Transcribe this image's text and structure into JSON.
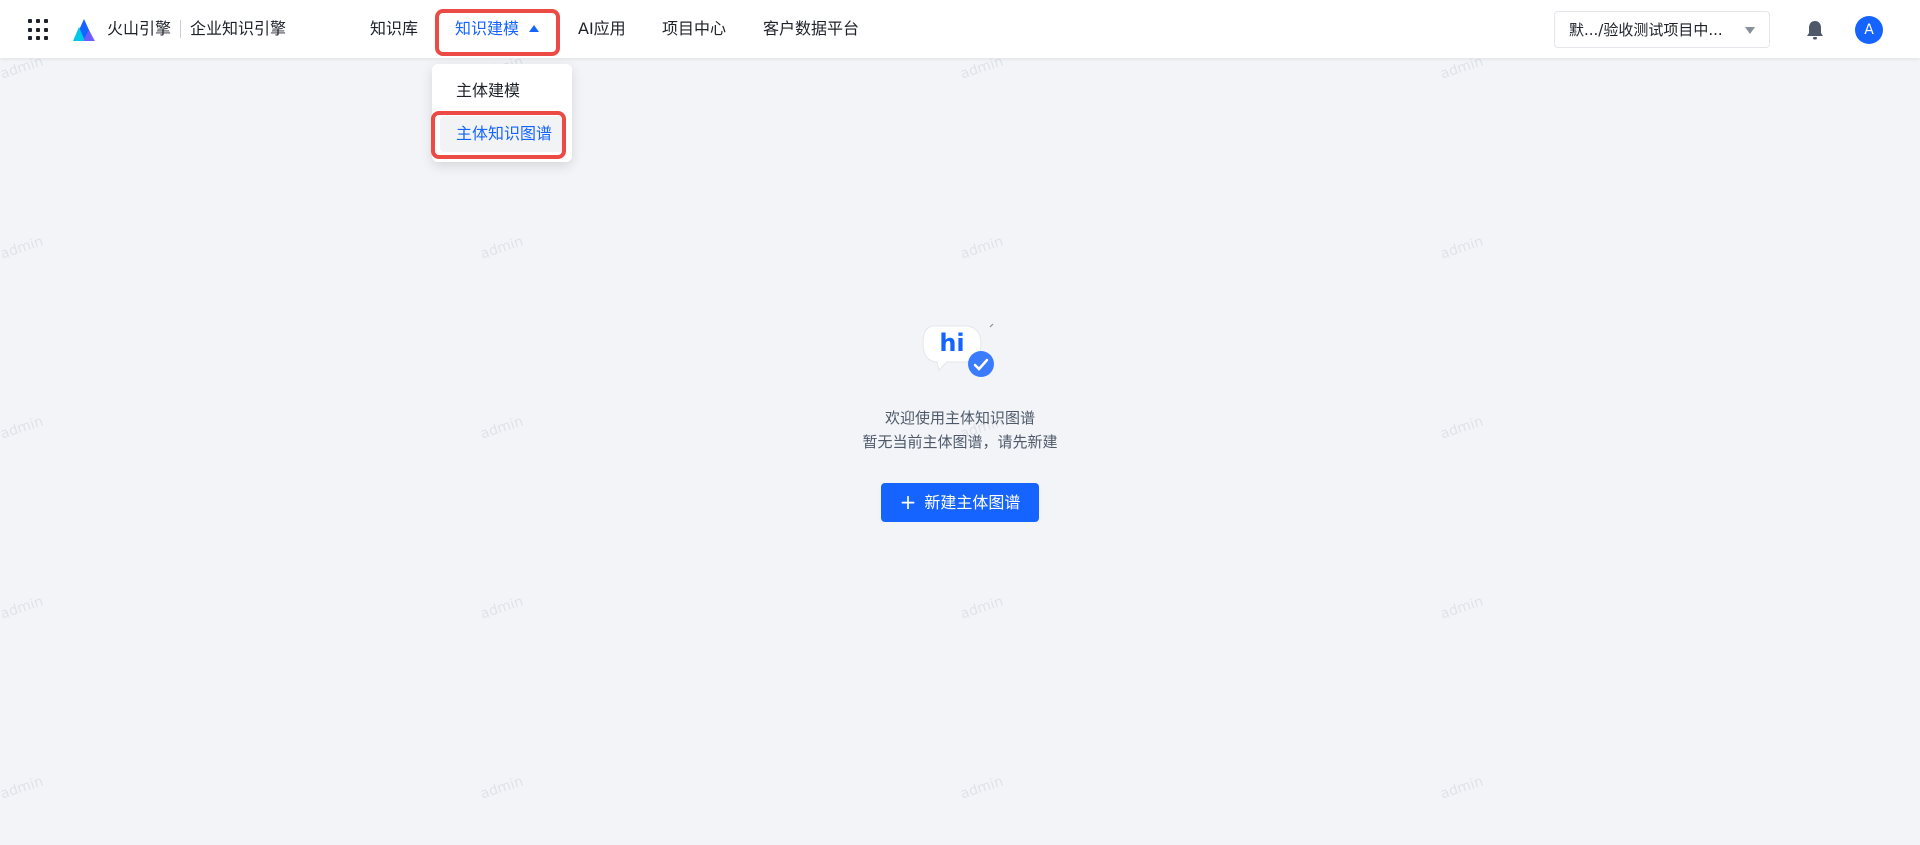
{
  "header": {
    "brand": "火山引擎",
    "product": "企业知识引擎",
    "nav": [
      {
        "label": "知识库"
      },
      {
        "label": "知识建模"
      },
      {
        "label": "AI应用"
      },
      {
        "label": "项目中心"
      },
      {
        "label": "客户数据平台"
      }
    ],
    "project_select": "默.../验收测试项目中...",
    "avatar_initial": "A"
  },
  "dropdown": {
    "items": [
      {
        "label": "主体建模"
      },
      {
        "label": "主体知识图谱"
      }
    ]
  },
  "empty_state": {
    "illustration_text": "hi",
    "line1": "欢迎使用主体知识图谱",
    "line2": "暂无当前主体图谱，请先新建",
    "create_button": "新建主体图谱"
  },
  "watermark": "admin",
  "colors": {
    "primary": "#1664ff",
    "highlight": "#ec4a44",
    "background": "#f2f4f8"
  },
  "icons": [
    "apps-grid-icon",
    "volcano-logo-icon",
    "caret-up-icon",
    "chevron-down-icon",
    "bell-icon",
    "plus-icon"
  ]
}
